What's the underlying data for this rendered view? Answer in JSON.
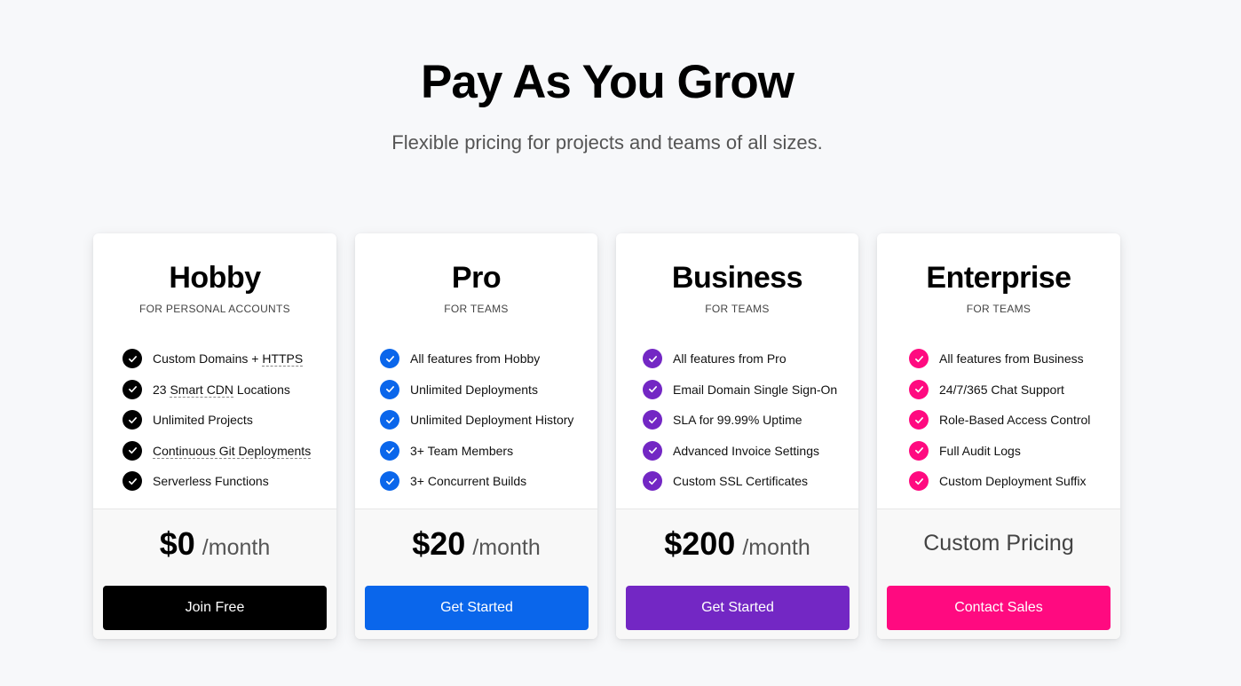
{
  "header": {
    "title": "Pay As You Grow",
    "subtitle": "Flexible pricing for projects and teams of all sizes."
  },
  "plans": [
    {
      "name": "Hobby",
      "audience": "FOR PERSONAL ACCOUNTS",
      "accent": "#000000",
      "features": [
        {
          "pre": "Custom Domains + ",
          "dotted": "HTTPS",
          "post": ""
        },
        {
          "pre": "23 ",
          "dotted": "Smart CDN",
          "post": " Locations"
        },
        {
          "pre": "Unlimited Projects",
          "dotted": "",
          "post": ""
        },
        {
          "pre": "",
          "dotted": "Continuous Git Deployments",
          "post": ""
        },
        {
          "pre": "Serverless Functions",
          "dotted": "",
          "post": ""
        }
      ],
      "price": "$0",
      "period": "/month",
      "custom_price": "",
      "cta": "Join Free"
    },
    {
      "name": "Pro",
      "audience": "FOR TEAMS",
      "accent": "#0a66eb",
      "features": [
        {
          "pre": "All features from Hobby",
          "dotted": "",
          "post": ""
        },
        {
          "pre": "Unlimited Deployments",
          "dotted": "",
          "post": ""
        },
        {
          "pre": "Unlimited Deployment History",
          "dotted": "",
          "post": ""
        },
        {
          "pre": "3+ Team Members",
          "dotted": "",
          "post": ""
        },
        {
          "pre": "3+ Concurrent Builds",
          "dotted": "",
          "post": ""
        }
      ],
      "price": "$20",
      "period": "/month",
      "custom_price": "",
      "cta": "Get Started"
    },
    {
      "name": "Business",
      "audience": "FOR TEAMS",
      "accent": "#7327c4",
      "features": [
        {
          "pre": "All features from Pro",
          "dotted": "",
          "post": ""
        },
        {
          "pre": "Email Domain Single Sign-On",
          "dotted": "",
          "post": ""
        },
        {
          "pre": "SLA for 99.99% Uptime",
          "dotted": "",
          "post": ""
        },
        {
          "pre": "Advanced Invoice Settings",
          "dotted": "",
          "post": ""
        },
        {
          "pre": "Custom SSL Certificates",
          "dotted": "",
          "post": ""
        }
      ],
      "price": "$200",
      "period": "/month",
      "custom_price": "",
      "cta": "Get Started"
    },
    {
      "name": "Enterprise",
      "audience": "FOR TEAMS",
      "accent": "#ff0a80",
      "features": [
        {
          "pre": "All features from Business",
          "dotted": "",
          "post": ""
        },
        {
          "pre": "24/7/365 Chat Support",
          "dotted": "",
          "post": ""
        },
        {
          "pre": "Role-Based Access Control",
          "dotted": "",
          "post": ""
        },
        {
          "pre": "Full Audit Logs",
          "dotted": "",
          "post": ""
        },
        {
          "pre": "Custom Deployment Suffix",
          "dotted": "",
          "post": ""
        }
      ],
      "price": "",
      "period": "",
      "custom_price": "Custom Pricing",
      "cta": "Contact Sales"
    }
  ],
  "icons": {
    "feature_check": "check-circle-icon"
  },
  "colors": {
    "background": "#f7f8fa",
    "card": "#ffffff",
    "card_footer": "#f8f8f8"
  }
}
